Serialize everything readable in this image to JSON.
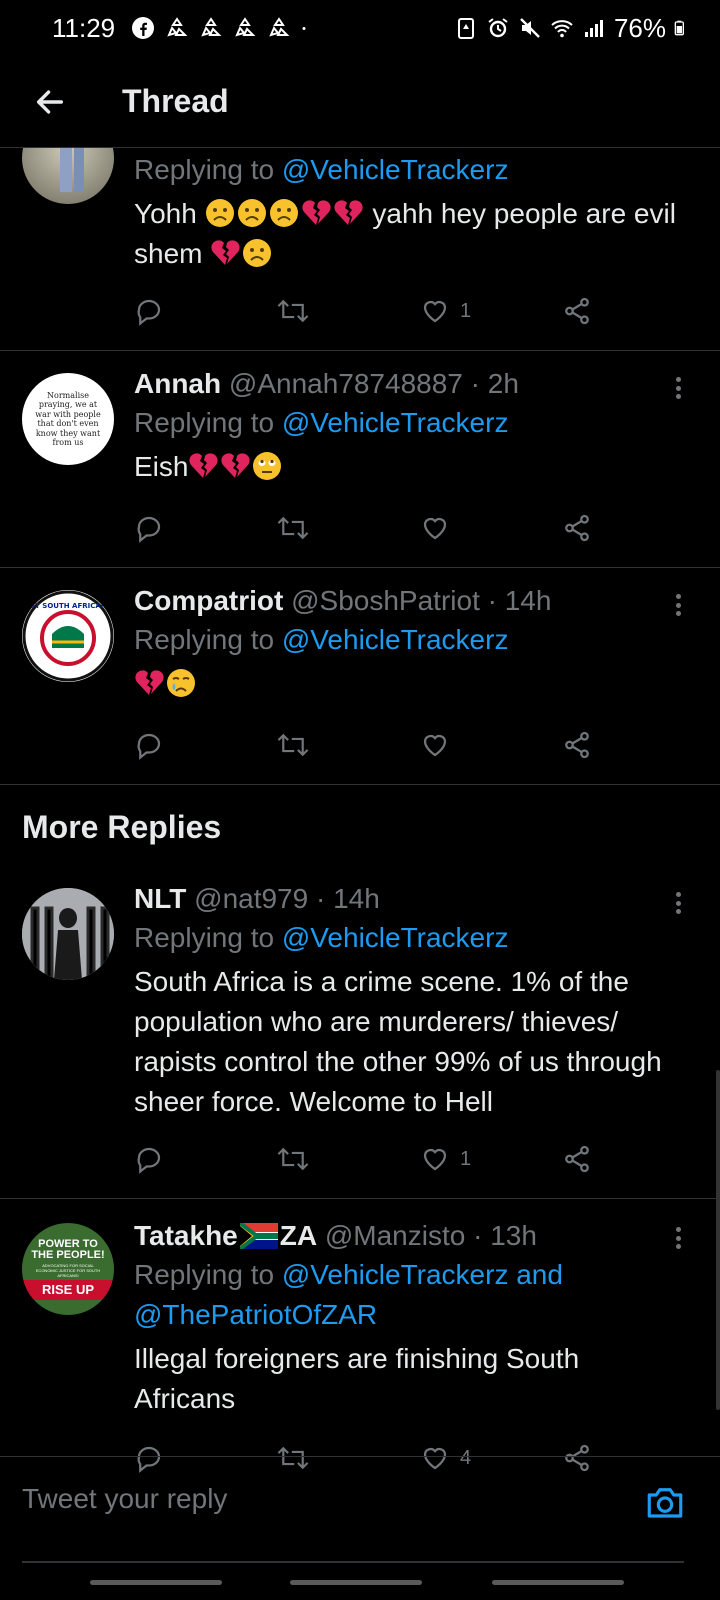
{
  "status_bar": {
    "time": "11:29",
    "battery": "76%"
  },
  "header": {
    "title": "Thread"
  },
  "tweets": [
    {
      "display_name": "",
      "handle": "",
      "time": "",
      "replying_prefix": "Replying to ",
      "replying_to": "@VehicleTrackerz",
      "text_before": "Yohh ",
      "text_after": " yahh hey people are evil shem ",
      "like_count": "1"
    },
    {
      "display_name": "Annah",
      "handle": "@Annah78748887 · 2h",
      "replying_prefix": "Replying to ",
      "replying_to": "@VehicleTrackerz",
      "text": "Eish",
      "avatar_text": "Normalise praying, we at war with people that don't even know they want from us",
      "like_count": ""
    },
    {
      "display_name": "Compatriot",
      "handle": "@SboshPatriot · 14h",
      "replying_prefix": "Replying to ",
      "replying_to": "@VehicleTrackerz",
      "text": "",
      "avatar_text": "PUT SOUTH AFRICANS",
      "like_count": ""
    }
  ],
  "more_replies": {
    "title": "More Replies",
    "tweets": [
      {
        "display_name": "NLT",
        "handle": "@nat979 · 14h",
        "replying_prefix": "Replying to ",
        "replying_to": "@VehicleTrackerz",
        "text": "South Africa is a crime scene. 1% of the population who are murderers/ thieves/ rapists control the other 99% of us through sheer force. Welcome to Hell",
        "like_count": "1"
      },
      {
        "display_name_a": "Tatakhe",
        "display_name_b": "ZA",
        "handle": "@Manzisto · 13h",
        "replying_prefix": "Replying to ",
        "replying_to": "@VehicleTrackerz and",
        "replying_to_2": "@ThePatriotOfZAR",
        "text": "Illegal foreigners are finishing South Africans",
        "avatar_text_top": "POWER TO THE PEOPLE!",
        "avatar_text_mid": "ADVOCATING FOR SOCIAL ECONOMIC JUSTICE FOR SOUTH AFRICANS!",
        "avatar_text_bottom": "RISE UP",
        "like_count": "4"
      }
    ]
  },
  "composer": {
    "placeholder": "Tweet your reply"
  },
  "colors": {
    "background": "#000000",
    "accent": "#1d9bf0",
    "muted": "#71767b",
    "divider": "#2f3336"
  }
}
